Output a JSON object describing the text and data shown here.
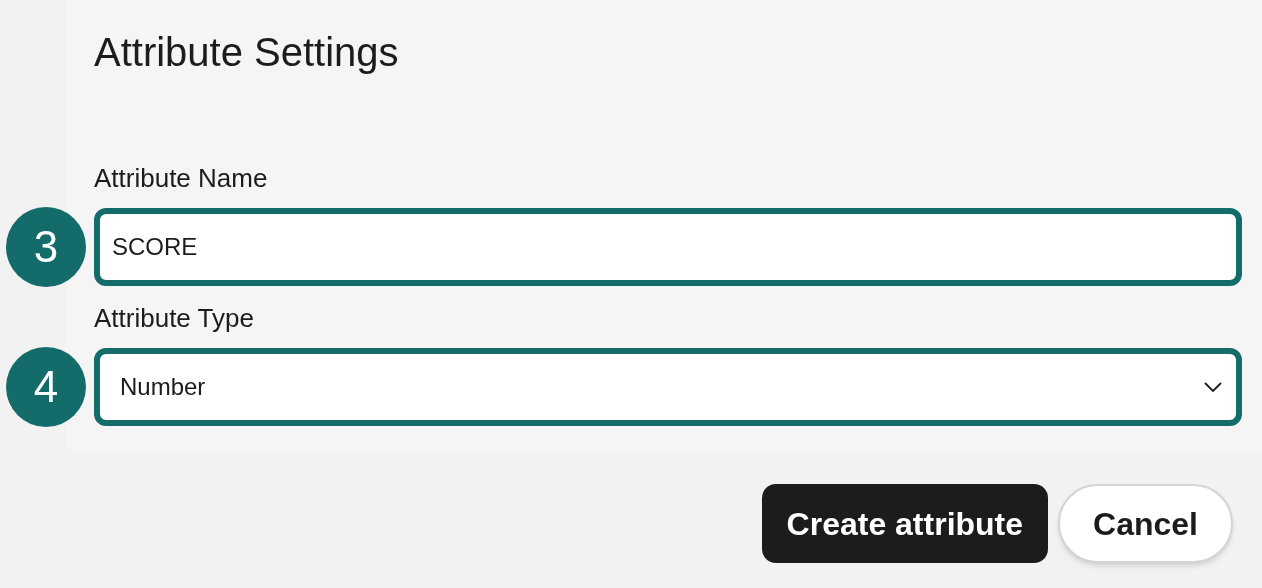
{
  "title": "Attribute Settings",
  "fields": [
    {
      "kind": "text",
      "step": "3",
      "label": "Attribute Name",
      "value": "SCORE"
    },
    {
      "kind": "select",
      "step": "4",
      "label": "Attribute Type",
      "value": "Number"
    }
  ],
  "buttons": [
    {
      "kind": "primary",
      "label": "Create attribute"
    },
    {
      "kind": "secondary",
      "label": "Cancel"
    }
  ]
}
